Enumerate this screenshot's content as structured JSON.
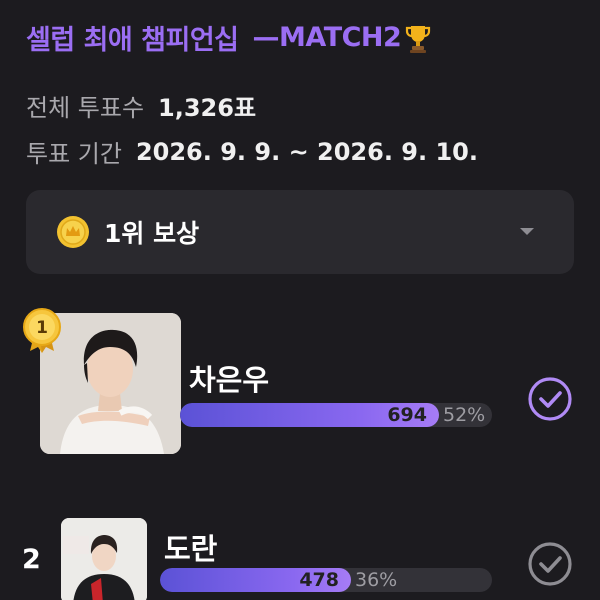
{
  "header": {
    "title": "셀럽 최애 챔피언십",
    "match": "—MATCH2"
  },
  "stats": {
    "total_label": "전체 투표수",
    "total_value": "1,326표",
    "period_label": "투표 기간",
    "period_value": "2026. 9. 9. ~ 2026. 9. 10."
  },
  "reward": {
    "label": "1위 보상"
  },
  "candidates": [
    {
      "rank": "1",
      "name": "차은우",
      "votes": "694",
      "percent": "52%",
      "share": 0.52
    },
    {
      "rank": "2",
      "name": "도란",
      "votes": "478",
      "percent": "36%",
      "share": 0.36
    }
  ],
  "colors": {
    "accent": "#9b6ef3",
    "bar_start": "#5b52d6",
    "bar_end": "#a67cf5",
    "check_selected": "#b08af5",
    "check_default": "#8e8d93"
  }
}
